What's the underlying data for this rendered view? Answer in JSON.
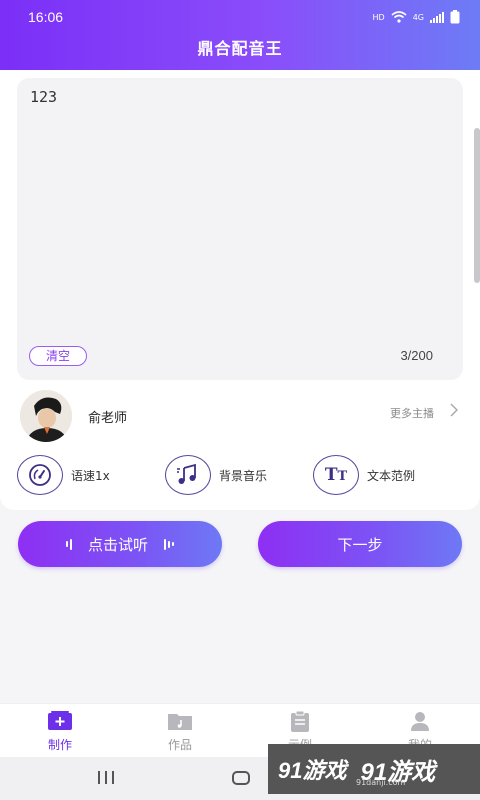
{
  "status_bar": {
    "time": "16:06",
    "network": "HD",
    "signal_label": "4G"
  },
  "app": {
    "title": "鼎合配音王"
  },
  "editor": {
    "text": "123",
    "clear_label": "清空",
    "count": "3/200"
  },
  "voice": {
    "name": "俞老师",
    "more_label": "更多主播",
    "more_icon": "chevron-right-icon"
  },
  "options": [
    {
      "label": "语速1x",
      "icon": "speedometer-icon"
    },
    {
      "label": "背景音乐",
      "icon": "music-note-icon"
    },
    {
      "label": "文本范例",
      "icon": "text-tt-icon"
    }
  ],
  "actions": {
    "preview_label": "点击试听",
    "next_label": "下一步"
  },
  "tabs": [
    {
      "label": "制作",
      "icon": "add-box-icon",
      "active": true
    },
    {
      "label": "作品",
      "icon": "music-folder-icon",
      "active": false
    },
    {
      "label": "示例",
      "icon": "clipboard-icon",
      "active": false
    },
    {
      "label": "我的",
      "icon": "user-icon",
      "active": false
    }
  ],
  "watermark": {
    "brand": "91游戏",
    "site": "91danji.com"
  },
  "colors": {
    "accent": "#7b2ff7",
    "accent_end": "#6e79f5",
    "tab_active": "#6e2fe8"
  }
}
